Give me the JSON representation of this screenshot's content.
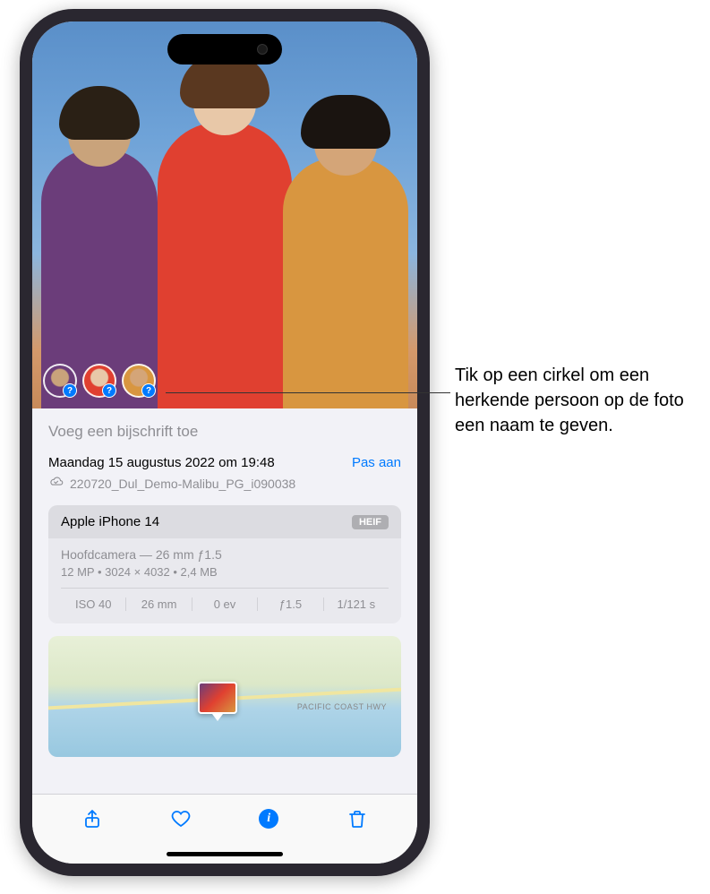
{
  "callout": {
    "text": "Tik op een cirkel om een herkende persoon op de foto een naam te geven."
  },
  "caption": {
    "placeholder": "Voeg een bijschrift toe"
  },
  "metadata": {
    "date": "Maandag 15 augustus 2022 om 19:48",
    "adjust_label": "Pas aan",
    "filename": "220720_Dul_Demo-Malibu_PG_i090038"
  },
  "camera": {
    "device": "Apple iPhone 14",
    "format": "HEIF",
    "lens": "Hoofdcamera — 26 mm ƒ1.5",
    "resolution": "12 MP • 3024 × 4032 • 2,4 MB",
    "specs": {
      "iso": "ISO 40",
      "focal": "26 mm",
      "ev": "0 ev",
      "aperture": "ƒ1.5",
      "shutter": "1/121 s"
    }
  },
  "map": {
    "road_label": "PACIFIC COAST HWY"
  },
  "toolbar": {
    "info_letter": "i"
  }
}
